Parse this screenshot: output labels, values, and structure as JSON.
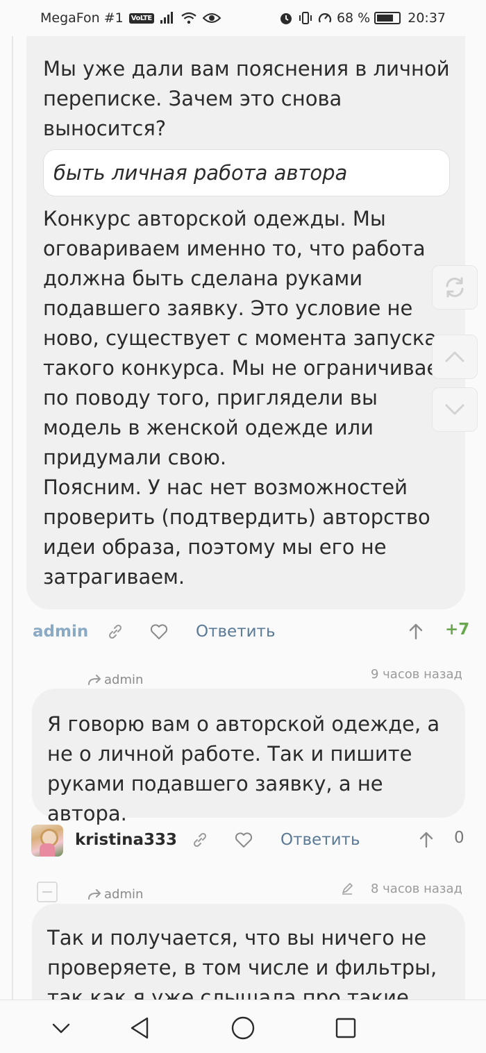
{
  "status_bar": {
    "carrier": "MegaFon #1",
    "volte": "VoLTE",
    "battery_percent": "68 %",
    "time": "20:37",
    "battery_level": 0.68
  },
  "comments": [
    {
      "text_before_quote": "Мы уже дали вам пояснения в личной переписке. Зачем это снова выносится?",
      "quote": "быть личная работа автора",
      "text_after_quote": "Конкурс авторской одежды. Мы оговариваем именно то, что работа должна быть сделана руками подавшего заявку. Это условие не ново, существует с момента запуска такого конкурса. Мы не ограничиваем по поводу того, приглядели вы модель в женской одежде или придумали свою.\nПоясним. У нас нет возможностей проверить (подтвердить) авторство идеи образа, поэтому мы его не затрагиваем.",
      "author": "admin",
      "reply_label": "Ответить",
      "rating": "+7"
    },
    {
      "reply_to": "admin",
      "timestamp": "9 часов назад",
      "text": "Я говорю вам о авторской одежде, а не о личной работе. Так и пишите руками подавшего заявку, а не автора.",
      "author": "kristina333",
      "reply_label": "Ответить",
      "rating": "0"
    },
    {
      "reply_to": "admin",
      "timestamp": "8 часов назад",
      "text": "Так и получается, что вы ничего не проверяете, в том числе и фильтры, так как я уже слышала про такие"
    }
  ],
  "icons": {
    "status": [
      "signal-icon",
      "wifi-icon",
      "eye-icon",
      "alarm-icon",
      "vibrate-icon",
      "data-saver-icon",
      "battery-icon"
    ],
    "actions": [
      "link-icon",
      "heart-icon",
      "arrow-up-icon"
    ],
    "floating": [
      "refresh-icon",
      "chevron-up-icon",
      "chevron-down-icon"
    ],
    "nav": [
      "nav-down-icon",
      "back-icon",
      "home-icon",
      "recents-icon"
    ]
  },
  "colors": {
    "bubble_bg": "#f0f0f0",
    "admin_name": "#8aa9c4",
    "reply_link": "#5a7a96",
    "rating_positive": "#6aa84f"
  }
}
